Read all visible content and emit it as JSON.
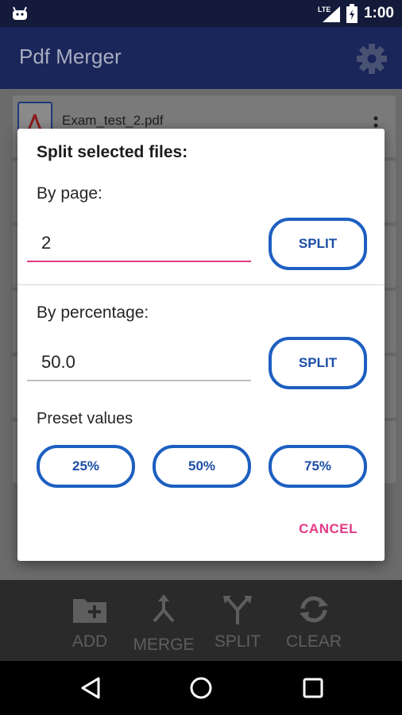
{
  "status_bar": {
    "time": "1:00",
    "network": "LTE"
  },
  "app_bar": {
    "title": "Pdf Merger"
  },
  "file_list": [
    {
      "name": "Exam_test_2.pdf"
    },
    {
      "name": ""
    },
    {
      "name": ""
    },
    {
      "name": ""
    },
    {
      "name": ""
    },
    {
      "name": ""
    }
  ],
  "dialog": {
    "title": "Split selected files:",
    "by_page": {
      "label": "By page:",
      "value": "2",
      "button": "SPLIT"
    },
    "by_percentage": {
      "label": "By percentage:",
      "value": "50.0",
      "button": "SPLIT"
    },
    "presets": {
      "label": "Preset values",
      "values": [
        "25%",
        "50%",
        "75%"
      ]
    },
    "cancel": "CANCEL"
  },
  "toolbar": {
    "add": "ADD",
    "merge": "MERGE",
    "split": "SPLIT",
    "clear": "CLEAR"
  },
  "colors": {
    "primary": "#1a2559",
    "accent": "#e33a86",
    "button_outline": "#1d5fc0"
  }
}
